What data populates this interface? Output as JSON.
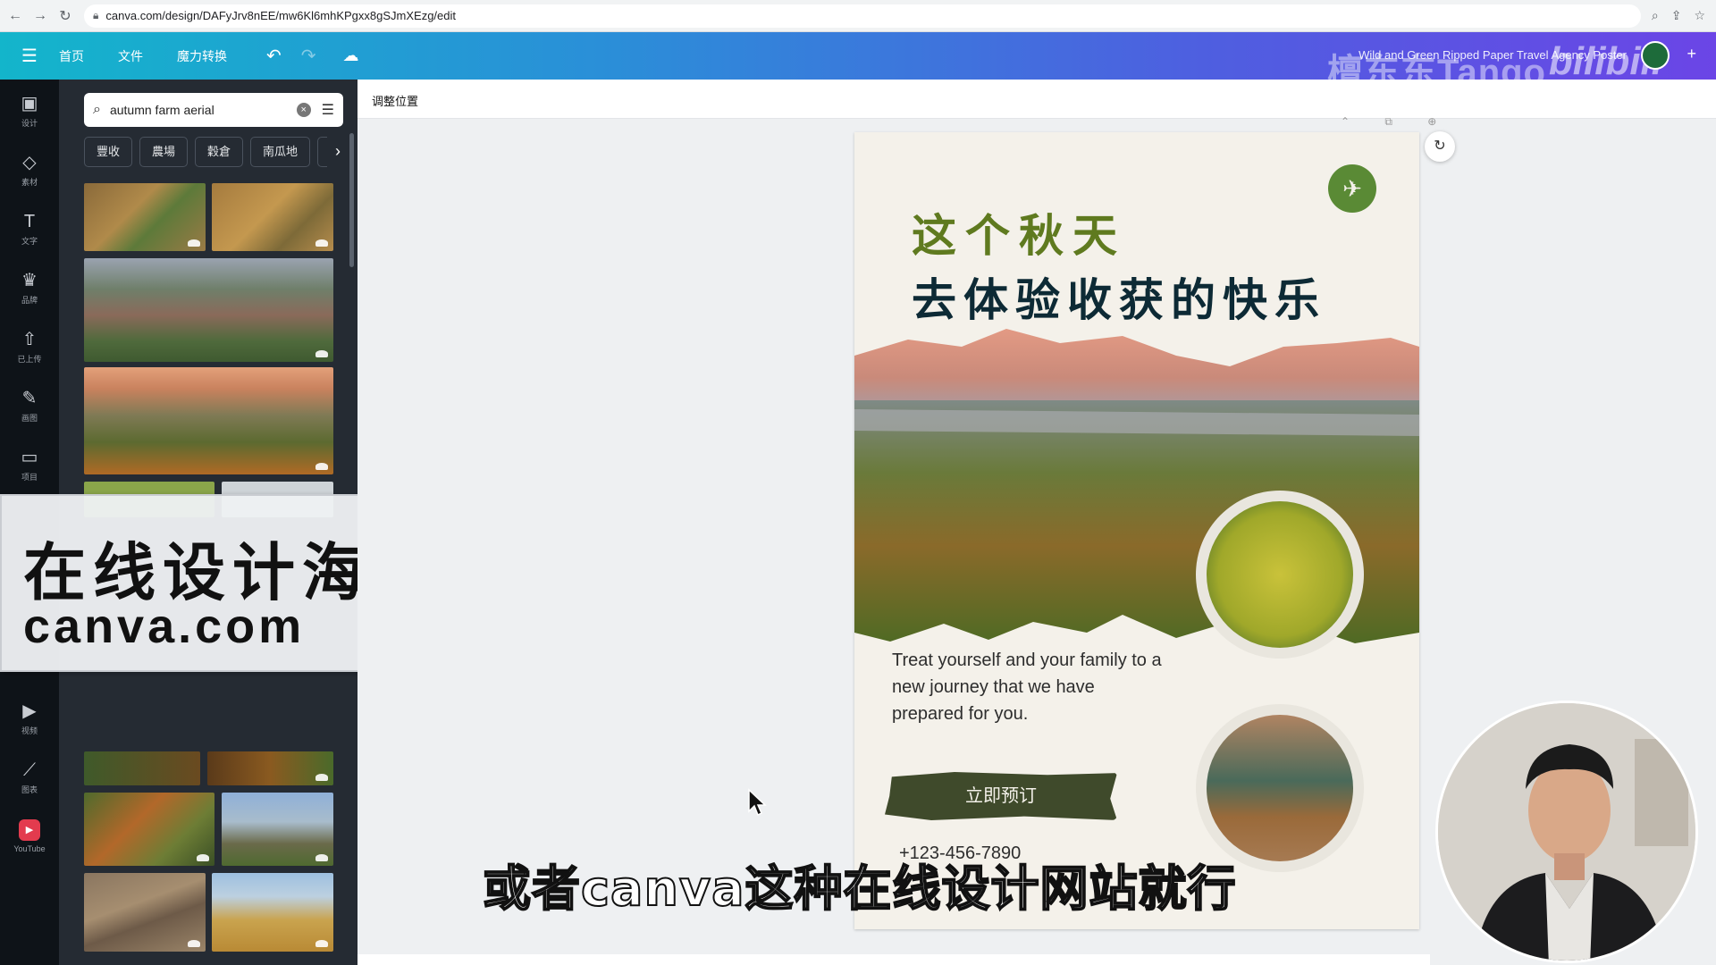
{
  "browser": {
    "url": "canva.com/design/DAFyJrv8nEE/mw6Kl6mhKPgxx8gSJmXEzg/edit"
  },
  "header": {
    "menu": [
      "首页",
      "文件",
      "魔力转换"
    ],
    "design_title": "Wild and Green Ripped Paper Travel Agency Poster",
    "watermark": "檀东东Tango",
    "watermark_logo": "bilibili"
  },
  "rail": [
    {
      "icon": "layout-icon",
      "label": "设计"
    },
    {
      "icon": "elements-icon",
      "label": "素材"
    },
    {
      "icon": "text-icon",
      "label": "文字"
    },
    {
      "icon": "brand-icon",
      "label": "品牌"
    },
    {
      "icon": "upload-icon",
      "label": "已上传"
    },
    {
      "icon": "draw-icon",
      "label": "画图"
    },
    {
      "icon": "folder-icon",
      "label": "项目"
    },
    {
      "icon": "video-icon",
      "label": "视频"
    },
    {
      "icon": "chart-icon",
      "label": "图表"
    },
    {
      "icon": "youtube-icon",
      "label": "YouTube"
    }
  ],
  "panel": {
    "search_value": "autumn farm aerial",
    "chips": [
      "豐收",
      "農場",
      "穀倉",
      "南瓜地",
      "農"
    ]
  },
  "overlay": {
    "line1": "在线设计海报",
    "line2": "canva.com"
  },
  "editor": {
    "context_label": "调整位置"
  },
  "poster": {
    "headline1": "这个秋天",
    "headline2": "去体验收获的快乐",
    "body": "Treat yourself and your family to a new journey that we have prepared for you.",
    "cta": "立即预订",
    "phone": "+123-456-7890"
  },
  "subtitle": "或者canva这种在线设计网站就行",
  "colors": {
    "header_start": "#13b5cb",
    "header_end": "#6b45e6",
    "rail_bg": "#0e1318",
    "panel_bg": "#252b33",
    "poster_green": "#5f7a1f",
    "poster_navy": "#0d2a35",
    "cta_bg": "#3f4a2b"
  }
}
